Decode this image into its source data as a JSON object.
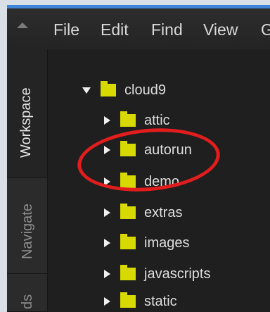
{
  "menu": {
    "items": [
      "File",
      "Edit",
      "Find",
      "View",
      "G"
    ]
  },
  "sidebar": {
    "tabs": [
      "Workspace",
      "Navigate",
      "ds"
    ]
  },
  "tree": {
    "root": "cloud9",
    "children": [
      "attic",
      "autorun",
      "demo",
      "extras",
      "images",
      "javascripts",
      "static"
    ]
  },
  "colors": {
    "folder": "#d7d900",
    "highlight": "#e11d1d",
    "background": "#1f1f1f"
  }
}
